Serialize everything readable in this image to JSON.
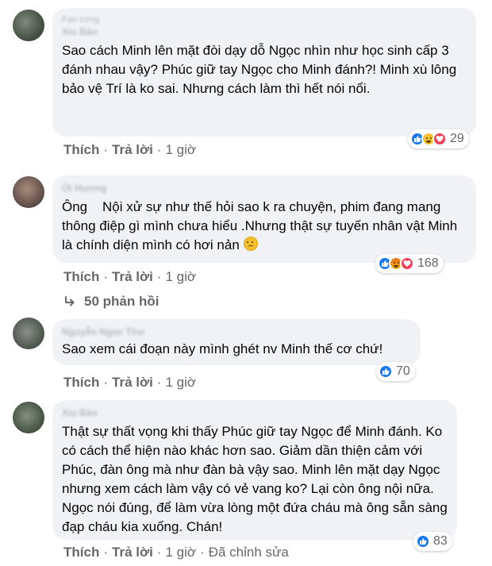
{
  "comments": [
    {
      "author": "Xiu Bảo",
      "badge": "Fan cứng",
      "text": "Sao cách Minh lên mặt đòi dạy dỗ Ngọc nhìn như học sinh cấp 3 đánh nhau vậy? Phúc giữ tay Ngọc cho Minh đánh?! Minh xù lông bảo vệ Trí là ko sai. Nhưng cách làm thì hết nói nổi.",
      "reactions": [
        "like",
        "haha",
        "love"
      ],
      "reaction_count": "29",
      "like_label": "Thích",
      "reply_label": "Trả lời",
      "time": "1 giờ"
    },
    {
      "author": "Út Hương",
      "text_before": "Ông    Nội xử sự như thế hỏi sao k ra chuyện, phim đang mang thông điệp gì mình chưa hiểu .Nhưng thật sự tuyến nhân vật Minh là chính diện mình có hơi nản ",
      "emoji": "frowning-face-emoji",
      "reactions": [
        "like",
        "angry",
        "love"
      ],
      "reaction_count": "168",
      "like_label": "Thích",
      "reply_label": "Trả lời",
      "time": "1 giờ",
      "replies_label": "50 phản hồi"
    },
    {
      "author": "Nguyễn Ngọc Thư",
      "text": "Sao xem cái đoạn này mình ghét nv Minh thế cơ chứ!",
      "reactions": [
        "like"
      ],
      "reaction_count": "70",
      "like_label": "Thích",
      "reply_label": "Trả lời",
      "time": "1 giờ"
    },
    {
      "author": "Xiu Bảo",
      "text": "Thật sự thất vọng khi thấy Phúc giữ tay Ngọc để Minh đánh. Ko có cách thể hiện nào khác hơn sao. Giảm dần thiện cảm với Phúc, đàn ông mà như đàn bà vậy sao. Minh lên mặt dạy Ngọc nhưng xem cách làm vậy có vẻ vang ko? Lại còn ông nội nữa. Ngọc nói đúng, để làm vừa lòng một đứa cháu mà ông sẵn sàng đạp cháu kia xuống. Chán!",
      "reactions": [
        "like"
      ],
      "reaction_count": "83",
      "like_label": "Thích",
      "reply_label": "Trả lời",
      "time": "1 giờ",
      "edited_label": "Đã chỉnh sửa"
    }
  ],
  "colors": {
    "bubble": "#f0f2f5",
    "meta": "#65676b",
    "like_blue": "#1877f2",
    "love_red": "#f33e58",
    "haha_yellow": "#f7c12d"
  }
}
